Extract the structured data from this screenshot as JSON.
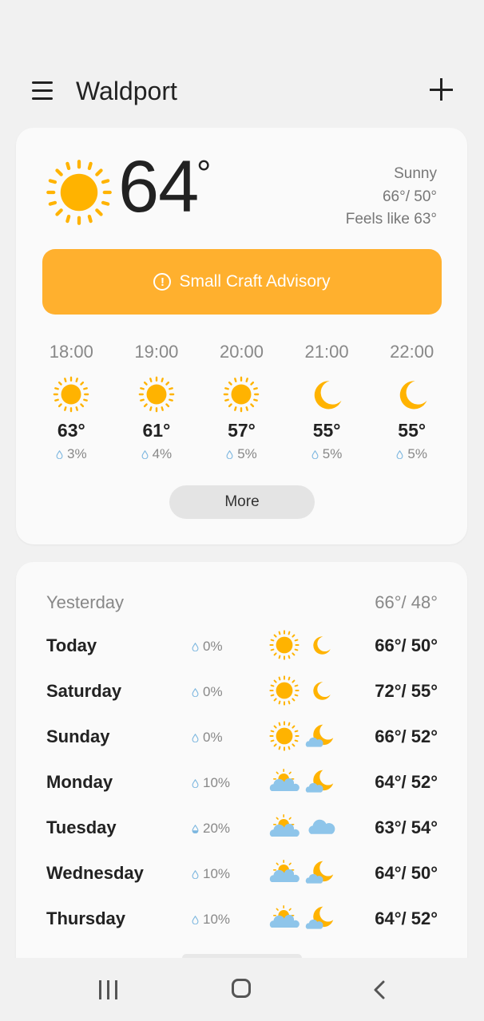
{
  "header": {
    "city": "Waldport"
  },
  "current": {
    "temp": "64",
    "degree": "°",
    "condition": "Sunny",
    "high_low": "66°/ 50°",
    "feels_like": "Feels like 63°",
    "icon": "sun-icon"
  },
  "advisory": {
    "label": "Small Craft Advisory",
    "icon": "alert-circle-icon"
  },
  "hourly": [
    {
      "time": "18:00",
      "icon": "sun-icon",
      "temp": "63°",
      "rain": "3%"
    },
    {
      "time": "19:00",
      "icon": "sun-icon",
      "temp": "61°",
      "rain": "4%"
    },
    {
      "time": "20:00",
      "icon": "sun-icon",
      "temp": "57°",
      "rain": "5%"
    },
    {
      "time": "21:00",
      "icon": "moon-icon",
      "temp": "55°",
      "rain": "5%"
    },
    {
      "time": "22:00",
      "icon": "moon-icon",
      "temp": "55°",
      "rain": "5%"
    }
  ],
  "more_label": "More",
  "yesterday": {
    "label": "Yesterday",
    "temps": "66°/ 48°"
  },
  "daily": [
    {
      "day": "Today",
      "rain": "0%",
      "icon_day": "sun-icon",
      "icon_night": "moon-icon",
      "temps": "66°/ 50°"
    },
    {
      "day": "Saturday",
      "rain": "0%",
      "icon_day": "sun-icon",
      "icon_night": "moon-icon",
      "temps": "72°/ 55°"
    },
    {
      "day": "Sunday",
      "rain": "0%",
      "icon_day": "sun-icon",
      "icon_night": "moon-cloud-icon",
      "temps": "66°/ 52°"
    },
    {
      "day": "Monday",
      "rain": "10%",
      "icon_day": "sun-cloud-icon",
      "icon_night": "moon-cloud-icon",
      "temps": "64°/ 52°"
    },
    {
      "day": "Tuesday",
      "rain": "20%",
      "icon_day": "sun-cloud-icon",
      "icon_night": "cloud-icon",
      "temps": "63°/ 54°"
    },
    {
      "day": "Wednesday",
      "rain": "10%",
      "icon_day": "sun-cloud-icon",
      "icon_night": "moon-cloud-icon",
      "temps": "64°/ 50°"
    },
    {
      "day": "Thursday",
      "rain": "10%",
      "icon_day": "sun-cloud-icon",
      "icon_night": "moon-cloud-icon",
      "temps": "64°/ 52°"
    }
  ],
  "colors": {
    "accent": "#ffb02e",
    "sun": "#ffb300",
    "cloud": "#8ec5ea",
    "background": "#f1f1f1"
  }
}
